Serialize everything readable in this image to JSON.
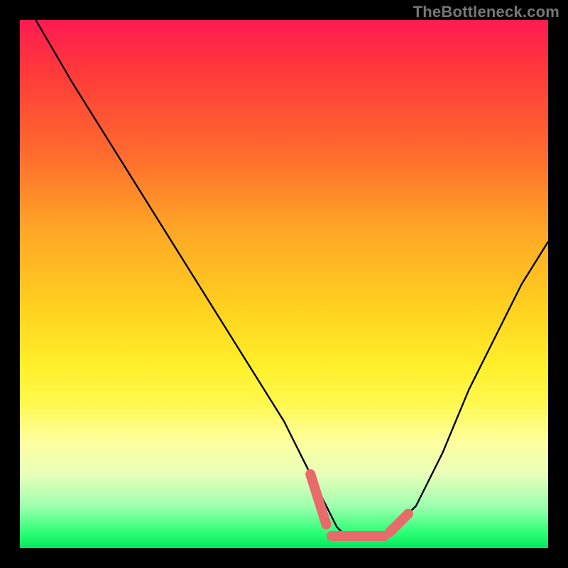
{
  "watermark": "TheBottleneck.com",
  "chart_data": {
    "type": "line",
    "title": "",
    "xlabel": "",
    "ylabel": "",
    "xlim": [
      0,
      100
    ],
    "ylim": [
      0,
      100
    ],
    "series": [
      {
        "name": "bottleneck-curve",
        "x": [
          3,
          10,
          20,
          30,
          40,
          50,
          55,
          58,
          60,
          62,
          65,
          68,
          70,
          75,
          80,
          85,
          90,
          95,
          100
        ],
        "values": [
          100,
          88,
          72,
          56,
          40,
          24,
          14,
          8,
          4,
          2,
          2,
          2,
          3,
          8,
          18,
          30,
          40,
          50,
          58
        ]
      }
    ],
    "annotations": [
      {
        "name": "optimal-marker-left",
        "type": "segment",
        "x": [
          55,
          58
        ],
        "y": [
          14,
          4.5
        ],
        "style": "thick-pink"
      },
      {
        "name": "optimal-marker-bottom",
        "type": "segment",
        "x": [
          59,
          69
        ],
        "y": [
          2.3,
          2.3
        ],
        "style": "thick-pink"
      },
      {
        "name": "optimal-marker-right",
        "type": "segment",
        "x": [
          70,
          73.5
        ],
        "y": [
          3.0,
          6.5
        ],
        "style": "thick-pink"
      }
    ]
  }
}
